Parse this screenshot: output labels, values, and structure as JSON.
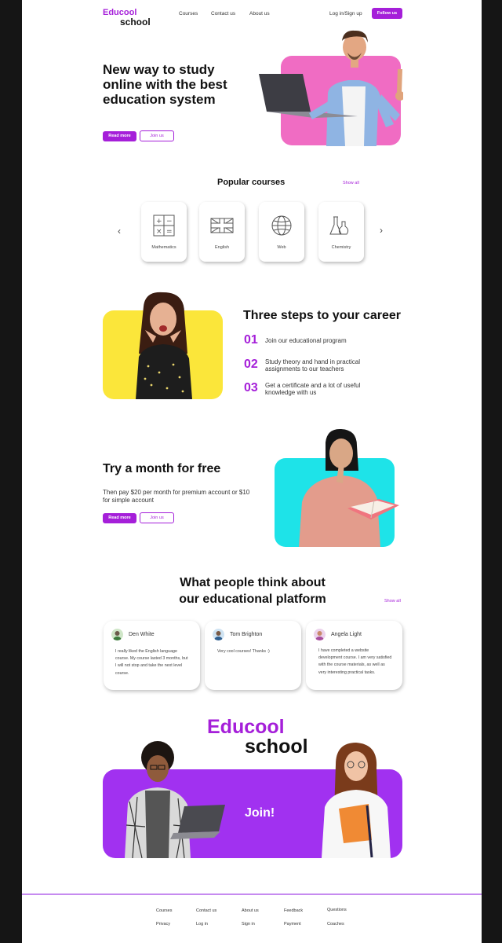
{
  "header": {
    "logo_line1": "Educool",
    "logo_line2": "school",
    "nav": [
      "Courses",
      "Contact us",
      "About us"
    ],
    "login": "Log in/Sign up",
    "follow": "Follow us"
  },
  "hero": {
    "title": "New way to study online with the best education system",
    "read_more": "Read more",
    "join_us": "Join us"
  },
  "courses": {
    "title": "Popular courses",
    "show_all": "Show all",
    "items": [
      {
        "label": "Mathematics",
        "icon": "calculator-icon"
      },
      {
        "label": "English",
        "icon": "uk-flag-icon"
      },
      {
        "label": "Web",
        "icon": "globe-icon"
      },
      {
        "label": "Chemistry",
        "icon": "flask-icon"
      }
    ]
  },
  "steps": {
    "title": "Three steps to your career",
    "items": [
      {
        "num": "01",
        "text": "Join our educational program"
      },
      {
        "num": "02",
        "text": "Study theory and hand in practical assignments to our teachers"
      },
      {
        "num": "03",
        "text": "Get a certificate and a lot of useful knowledge with us"
      }
    ]
  },
  "trial": {
    "title": "Try a month for free",
    "text": "Then pay $20 per month for premium account or $10 for simple account",
    "read_more": "Read more",
    "join_us": "Join us"
  },
  "reviews": {
    "title_line1": "What people think about",
    "title_line2": "our educational platform",
    "show_all": "Show all",
    "items": [
      {
        "name": "Den White",
        "text": "I really liked the English language course. My course lasted 3 months, but I will not stop and take the next level course."
      },
      {
        "name": "Tom Brighton",
        "text": "Very cool courses! Thanks :)"
      },
      {
        "name": "Angela Light",
        "text": "I have completed a website development course. I am very satisfied with the course materials, as well as very interesting practical tasks."
      }
    ]
  },
  "join_banner": {
    "logo_line1": "Educool",
    "logo_line2": "school",
    "cta": "Join!"
  },
  "footer": {
    "col1": [
      "Courses",
      "Privacy"
    ],
    "col2": [
      "Contact us",
      "Log in"
    ],
    "col3": [
      "About us",
      "Sign in"
    ],
    "col4": [
      "Feedback",
      "Payment"
    ],
    "col5": [
      "Questions",
      "Coaches"
    ]
  },
  "colors": {
    "accent": "#a51fd9",
    "hero_bg": "#f06cc3",
    "steps_bg": "#fbe63a",
    "trial_bg": "#1ee3e8",
    "banner_bg": "#a131f0"
  }
}
